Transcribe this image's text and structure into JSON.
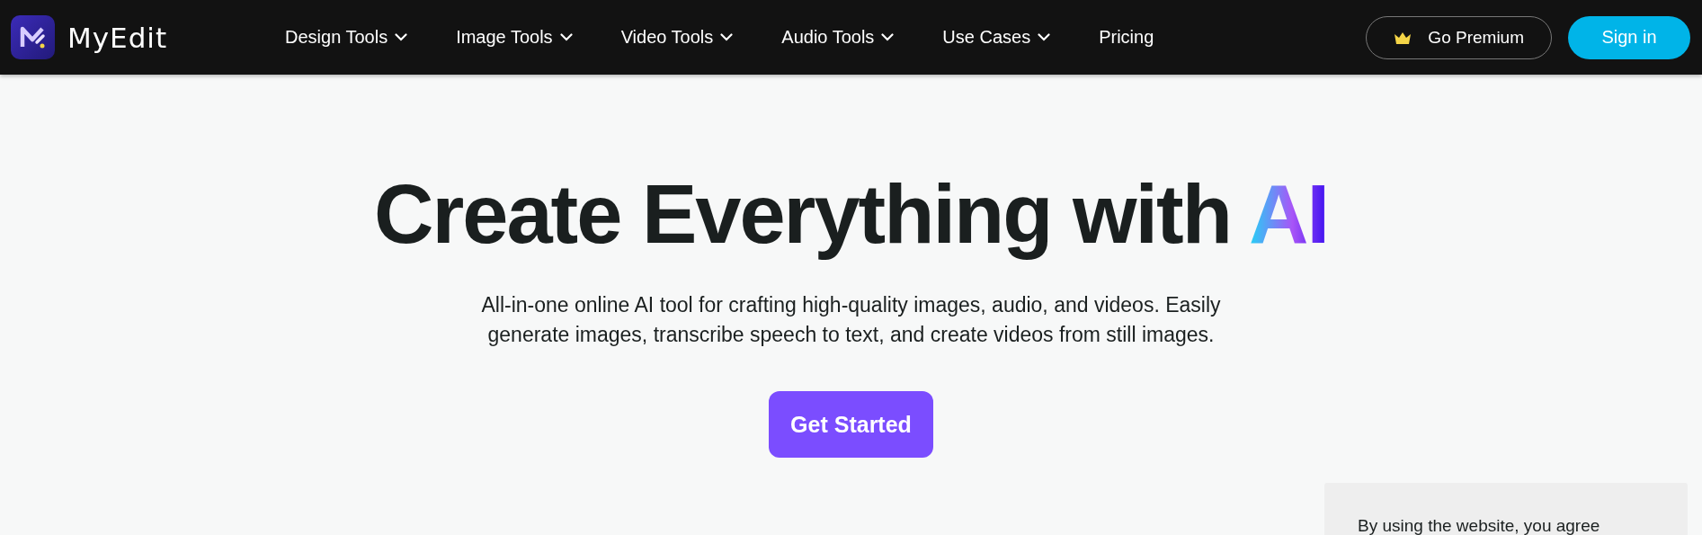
{
  "header": {
    "logo_text": "MyEdit",
    "menu": [
      {
        "label": "Design Tools",
        "has_dropdown": true
      },
      {
        "label": "Image Tools",
        "has_dropdown": true
      },
      {
        "label": "Video Tools",
        "has_dropdown": true
      },
      {
        "label": "Audio Tools",
        "has_dropdown": true
      },
      {
        "label": "Use Cases",
        "has_dropdown": true
      },
      {
        "label": "Pricing",
        "has_dropdown": false
      }
    ],
    "premium_button": "Go Premium",
    "sign_in_button": "Sign in"
  },
  "hero": {
    "title": "Create Everything with ",
    "title_highlight": "AI",
    "subtitle": "All-in-one online AI tool for crafting high-quality images, audio, and videos. Easily generate images, transcribe speech to text, and create videos from still images.",
    "cta": "Get Started"
  },
  "cookie_notice": {
    "text": "By using the website, you agree"
  }
}
